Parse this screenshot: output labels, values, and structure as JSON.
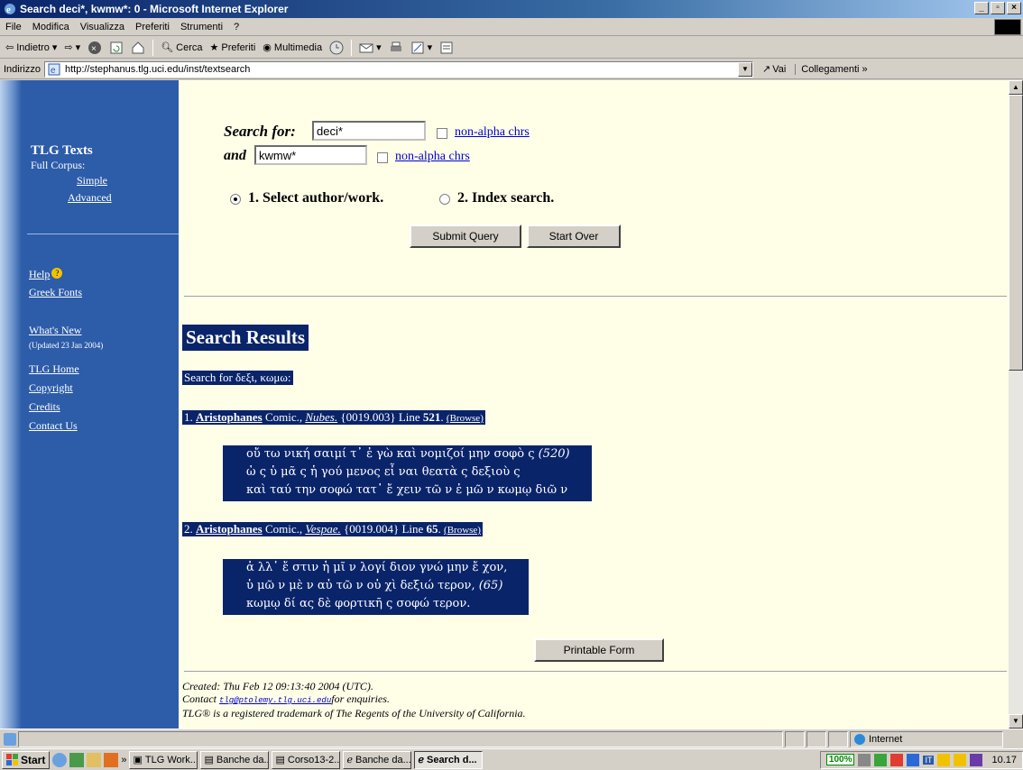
{
  "window": {
    "title": "Search deci*, kwmw*: 0 - Microsoft Internet Explorer",
    "minimize": "_",
    "restore": "▫",
    "close": "×"
  },
  "menu": [
    "File",
    "Modifica",
    "Visualizza",
    "Preferiti",
    "Strumenti",
    "?"
  ],
  "toolbar": {
    "back": "Indietro",
    "search": "Cerca",
    "favorites": "Preferiti",
    "media": "Multimedia"
  },
  "address": {
    "label": "Indirizzo",
    "url": "http://stephanus.tlg.uci.edu/inst/textsearch",
    "go": "Vai",
    "links": "Collegamenti"
  },
  "sidebar": {
    "title": "TLG Texts",
    "full_corpus": "Full Corpus:",
    "simple": "Simple",
    "advanced": "Advanced",
    "help": "Help",
    "greek_fonts": "Greek Fonts",
    "whats_new": "What's New",
    "updated": "(Updated 23 Jan 2004)",
    "tlg_home": "TLG Home",
    "copyright": "Copyright",
    "credits": "Credits",
    "contact": "Contact Us"
  },
  "form": {
    "search_for_label": "Search for:",
    "search_for_value": "deci*",
    "and_label": "and",
    "and_value": "kwmw*",
    "nonalpha1": "non-alpha chrs",
    "nonalpha2": "non-alpha chrs",
    "option1": "1. Select author/work.",
    "option2": "2. Index search.",
    "submit": "Submit Query",
    "start_over": "Start Over"
  },
  "results": {
    "heading": "Search Results",
    "search_for": "Search for δεξι, κωμω:",
    "items": [
      {
        "num": "1.",
        "author": "Aristophanes",
        "genre": "Comic.,",
        "work": "Nubes.",
        "ref": "{0019.003} Line",
        "line": "521",
        "browse": "(Browse)",
        "lines": [
          "οὔ τω νική σαιμί   τ᾽ ἐ γὼ  καὶ   νομιζοί μην σοφὸ ς",
          "ὡ ς ὑ μᾶ ς ἡ γού μενος εἶ ναι θεατὰ ς δεξιοὺ ς",
          "καὶ   ταύ την σοφώ τατ᾽ ἔ χειν τῶ ν ἐ μῶ ν κωμῳ διῶ ν"
        ],
        "mark": "(520)"
      },
      {
        "num": "2.",
        "author": "Aristophanes",
        "genre": "Comic.,",
        "work": "Vespae.",
        "ref": "{0019.004} Line",
        "line": "65",
        "browse": "(Browse)",
        "lines": [
          "ἀ λλ᾽ ἔ στιν ἡ μῖ ν λογί διον γνώ μην ἔ χον,",
          "ὑ μῶ ν μὲ ν αὐ τῶ ν οὐ χὶ  δεξιώ τερον,",
          "κωμῳ δί ας δὲ  φορτικῆ ς σοφώ τερον."
        ],
        "mark": "(65)"
      }
    ],
    "printable": "Printable Form"
  },
  "footer": {
    "created": "Created: Thu Feb 12 09:13:40 2004 (UTC).",
    "contact_pre": "Contact",
    "contact_email": "tlg@ptolemy.tlg.uci.edu",
    "contact_post": "for enquiries.",
    "trademark": "TLG® is a registered trademark of The Regents of the University of California."
  },
  "status": {
    "zone": "Internet"
  },
  "taskbar": {
    "start": "Start",
    "chevron": "»",
    "tasks": [
      "TLG Work...",
      "Banche da...",
      "Corso13-2...",
      "Banche da...",
      "Search d..."
    ],
    "zoom": "100%",
    "lang": "IT",
    "time": "10.17"
  }
}
